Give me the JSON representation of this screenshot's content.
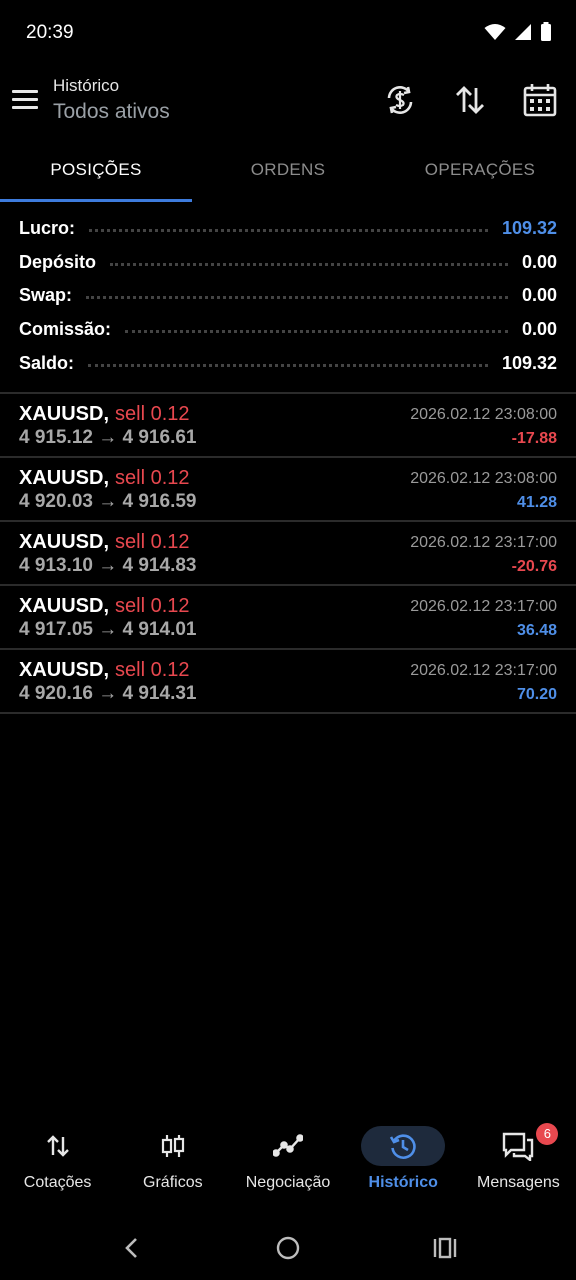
{
  "status_bar": {
    "time": "20:39"
  },
  "header": {
    "title": "Histórico",
    "subtitle": "Todos ativos"
  },
  "tabs": [
    {
      "label": "POSIÇÕES",
      "active": true
    },
    {
      "label": "ORDENS",
      "active": false
    },
    {
      "label": "OPERAÇÕES",
      "active": false
    }
  ],
  "summary": {
    "profit_label": "Lucro:",
    "profit_value": "109.32",
    "deposit_label": "Depósito",
    "deposit_value": "0.00",
    "swap_label": "Swap:",
    "swap_value": "0.00",
    "commission_label": "Comissão:",
    "commission_value": "0.00",
    "balance_label": "Saldo:",
    "balance_value": "109.32"
  },
  "deals": [
    {
      "symbol": "XAUUSD,",
      "side": "sell 0.12",
      "prices": "4 915.12 → 4 916.61",
      "time": "2026.02.12 23:08:00",
      "profit": "-17.88",
      "profit_sign": "neg"
    },
    {
      "symbol": "XAUUSD,",
      "side": "sell 0.12",
      "prices": "4 920.03 → 4 916.59",
      "time": "2026.02.12 23:08:00",
      "profit": "41.28",
      "profit_sign": "pos"
    },
    {
      "symbol": "XAUUSD,",
      "side": "sell 0.12",
      "prices": "4 913.10 → 4 914.83",
      "time": "2026.02.12 23:17:00",
      "profit": "-20.76",
      "profit_sign": "neg"
    },
    {
      "symbol": "XAUUSD,",
      "side": "sell 0.12",
      "prices": "4 917.05 → 4 914.01",
      "time": "2026.02.12 23:17:00",
      "profit": "36.48",
      "profit_sign": "pos"
    },
    {
      "symbol": "XAUUSD,",
      "side": "sell 0.12",
      "prices": "4 920.16 → 4 914.31",
      "time": "2026.02.12 23:17:00",
      "profit": "70.20",
      "profit_sign": "pos"
    }
  ],
  "bottom_nav": [
    {
      "label": "Cotações",
      "icon": "quotes-arrows-icon",
      "active": false
    },
    {
      "label": "Gráficos",
      "icon": "candlestick-chart-icon",
      "active": false
    },
    {
      "label": "Negociação",
      "icon": "trade-line-icon",
      "active": false
    },
    {
      "label": "Histórico",
      "icon": "history-clock-icon",
      "active": true
    },
    {
      "label": "Mensagens",
      "icon": "messages-icon",
      "active": false,
      "badge": "6"
    }
  ],
  "colors": {
    "accent": "#4f8fe8",
    "tab_indicator": "#3d7bdc",
    "negative": "#e8484f",
    "background": "#000000"
  }
}
